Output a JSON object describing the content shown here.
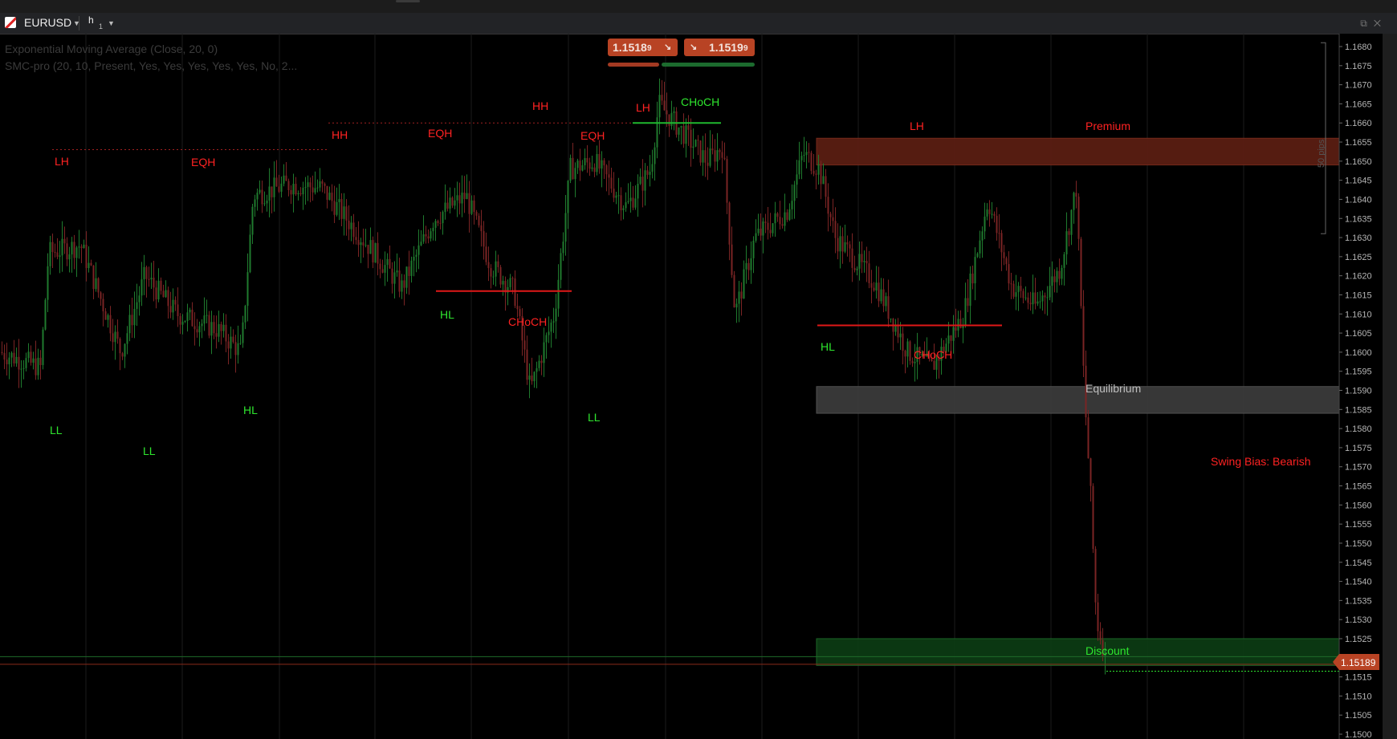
{
  "symbol": "EURUSD",
  "timeframe": "h",
  "timeframe_multiplier": "1",
  "indicators": [
    "Exponential Moving Average (Close, 20, 0)",
    "SMC-pro (20, 10, Present, Yes, Yes, Yes, Yes, Yes, No, 2..."
  ],
  "quote": {
    "sell": "1.1518",
    "sell_pip": "9",
    "buy": "1.1519",
    "buy_pip": "9",
    "current_price": "1.15189",
    "sell_arrow": "↘",
    "buy_arrow": "↘"
  },
  "ruler_label": "50 pips",
  "colors": {
    "bull": "#1f7a2e",
    "bear": "#7a2424",
    "label_red": "#ff2222",
    "label_green": "#2ee52e",
    "premium_zone": "#5a1e12",
    "equilibrium_zone": "#3a3a3a",
    "discount_zone": "#0c3a14",
    "price_tag": "#b84324"
  },
  "chart_data": {
    "type": "candlestick",
    "ylim": [
      1.15,
      1.168
    ],
    "y_ticks": [
      "1.1680",
      "1.1675",
      "1.1670",
      "1.1665",
      "1.1660",
      "1.1655",
      "1.1650",
      "1.1645",
      "1.1640",
      "1.1635",
      "1.1630",
      "1.1625",
      "1.1620",
      "1.1615",
      "1.1610",
      "1.1605",
      "1.1600",
      "1.1595",
      "1.1590",
      "1.1585",
      "1.1580",
      "1.1575",
      "1.1570",
      "1.1565",
      "1.1560",
      "1.1555",
      "1.1550",
      "1.1545",
      "1.1540",
      "1.1535",
      "1.1530",
      "1.1525",
      "1.1520",
      "1.1515",
      "1.1510",
      "1.1505",
      "1.1500"
    ],
    "price_path": [
      [
        0,
        1.16
      ],
      [
        50,
        1.1596
      ],
      [
        60,
        1.1626
      ],
      [
        100,
        1.1628
      ],
      [
        150,
        1.16
      ],
      [
        180,
        1.162
      ],
      [
        220,
        1.161
      ],
      [
        270,
        1.1606
      ],
      [
        300,
        1.16
      ],
      [
        315,
        1.1641
      ],
      [
        360,
        1.1644
      ],
      [
        400,
        1.1643
      ],
      [
        450,
        1.163
      ],
      [
        500,
        1.1617
      ],
      [
        540,
        1.1635
      ],
      [
        580,
        1.1641
      ],
      [
        610,
        1.1623
      ],
      [
        640,
        1.1616
      ],
      [
        660,
        1.159
      ],
      [
        690,
        1.161
      ],
      [
        710,
        1.1648
      ],
      [
        740,
        1.165
      ],
      [
        780,
        1.1638
      ],
      [
        810,
        1.1648
      ],
      [
        820,
        1.1665
      ],
      [
        840,
        1.166
      ],
      [
        880,
        1.165
      ],
      [
        900,
        1.1654
      ],
      [
        915,
        1.161
      ],
      [
        940,
        1.163
      ],
      [
        980,
        1.1637
      ],
      [
        1000,
        1.1652
      ],
      [
        1020,
        1.1648
      ],
      [
        1040,
        1.163
      ],
      [
        1090,
        1.1618
      ],
      [
        1130,
        1.16
      ],
      [
        1160,
        1.1596
      ],
      [
        1200,
        1.161
      ],
      [
        1230,
        1.164
      ],
      [
        1260,
        1.1617
      ],
      [
        1290,
        1.1612
      ],
      [
        1320,
        1.1622
      ],
      [
        1340,
        1.1643
      ],
      [
        1350,
        1.159
      ],
      [
        1358,
        1.1562
      ],
      [
        1365,
        1.153
      ],
      [
        1378,
        1.1519
      ]
    ],
    "levels": [
      {
        "label": "EQH",
        "price": 1.1653,
        "style": "dotted",
        "color": "red"
      },
      {
        "label": "EQH",
        "price": 1.166,
        "style": "dotted",
        "color": "red"
      },
      {
        "label": "CHoCH",
        "price": 1.1616,
        "style": "solid",
        "color": "red"
      },
      {
        "label": "CHoCH",
        "price": 1.166,
        "style": "solid",
        "color": "green"
      },
      {
        "label": "CHoCH",
        "price": 1.1607,
        "style": "solid",
        "color": "red"
      }
    ],
    "zones": [
      {
        "label": "Premium",
        "from": 1.1649,
        "to": 1.1656
      },
      {
        "label": "Equilibrium",
        "from": 1.1584,
        "to": 1.1591
      },
      {
        "label": "Discount",
        "from": 1.1518,
        "to": 1.1525
      }
    ],
    "structure_labels": [
      {
        "text": "LH",
        "color": "red"
      },
      {
        "text": "EQH",
        "color": "red"
      },
      {
        "text": "HH",
        "color": "red"
      },
      {
        "text": "EQH",
        "color": "red"
      },
      {
        "text": "HH",
        "color": "red"
      },
      {
        "text": "EQH",
        "color": "red"
      },
      {
        "text": "LH",
        "color": "red"
      },
      {
        "text": "CHoCH",
        "color": "green"
      },
      {
        "text": "LH",
        "color": "red"
      },
      {
        "text": "LL",
        "color": "green"
      },
      {
        "text": "LL",
        "color": "green"
      },
      {
        "text": "HL",
        "color": "green"
      },
      {
        "text": "HL",
        "color": "green"
      },
      {
        "text": "CHoCH",
        "color": "red"
      },
      {
        "text": "LL",
        "color": "green"
      },
      {
        "text": "HL",
        "color": "green"
      },
      {
        "text": "CHoCH",
        "color": "red"
      },
      {
        "text": "Premium",
        "color": "red"
      },
      {
        "text": "Equilibrium",
        "color": "gray"
      },
      {
        "text": "Discount",
        "color": "green"
      },
      {
        "text": "Swing Bias: Bearish",
        "color": "red"
      }
    ]
  }
}
